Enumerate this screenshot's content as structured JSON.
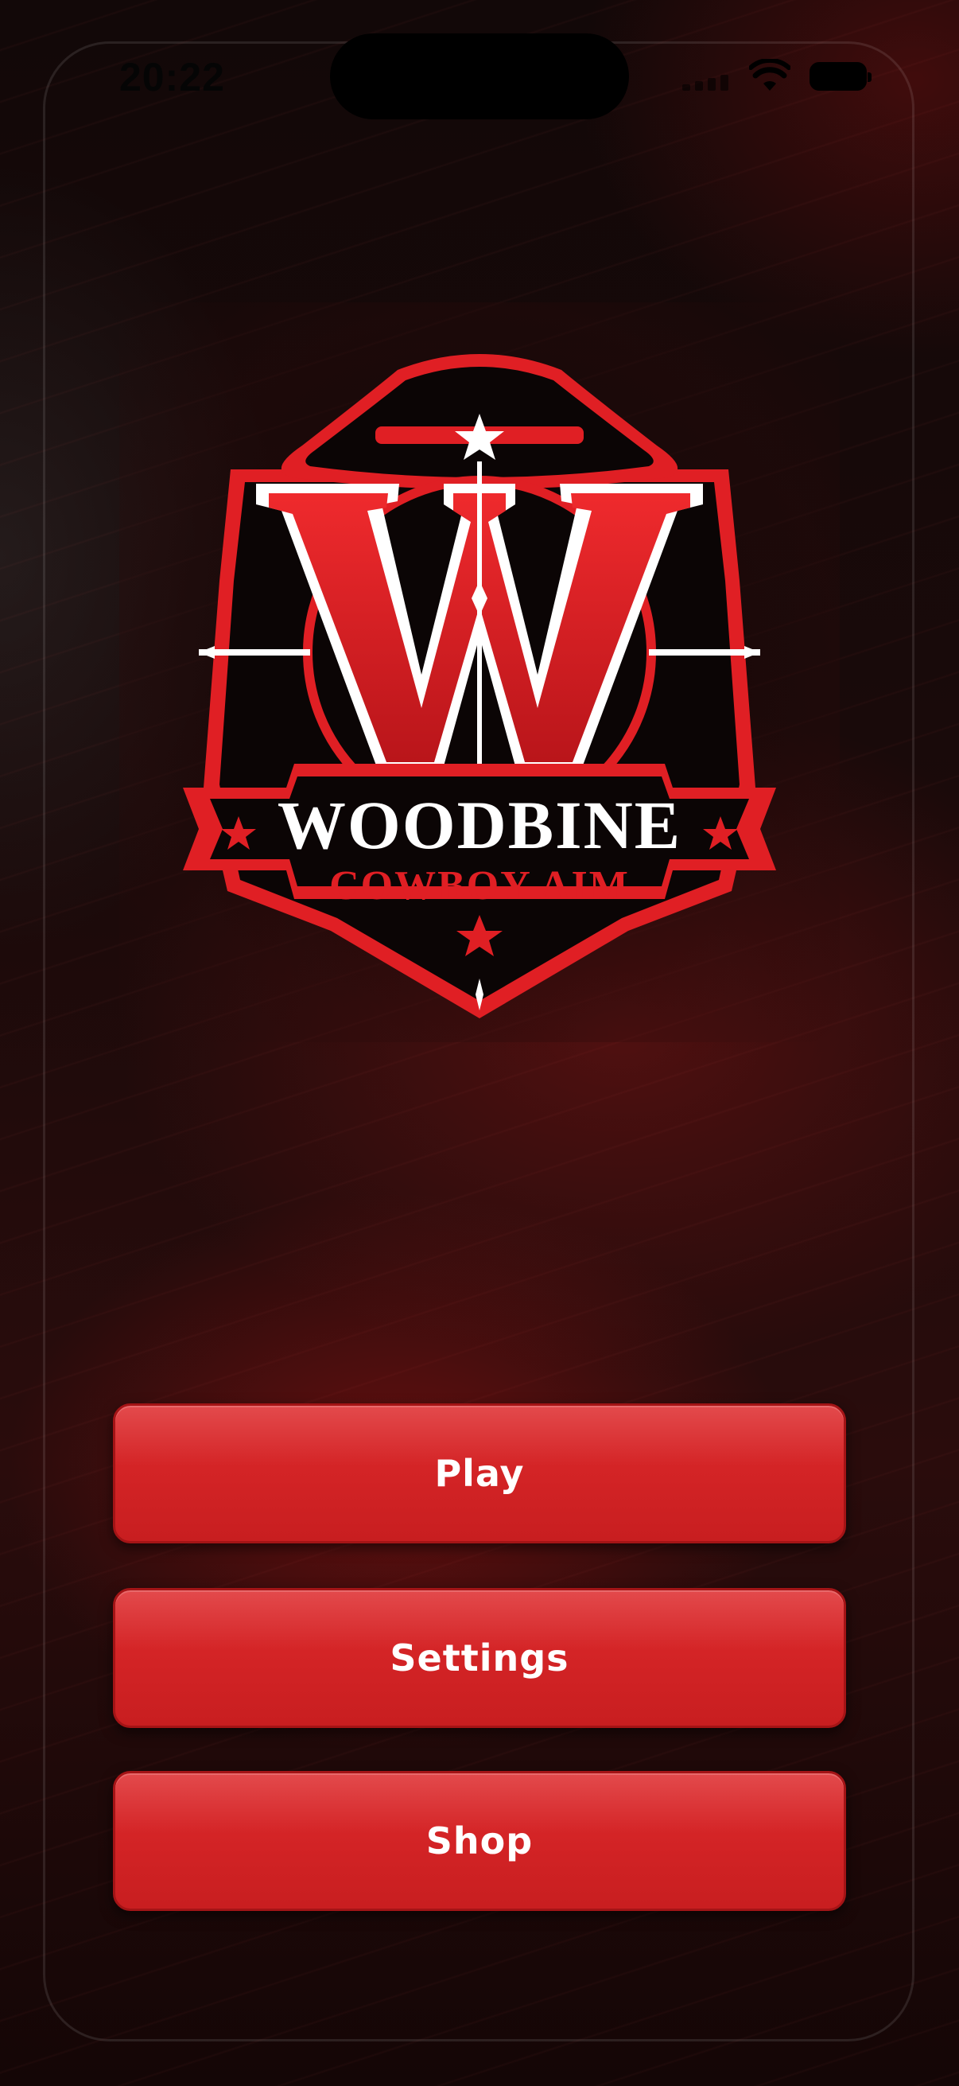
{
  "status_bar": {
    "time": "20:22",
    "icons": [
      "cellular-signal-icon",
      "wifi-icon",
      "battery-icon"
    ]
  },
  "logo": {
    "monogram": "W",
    "title": "WOODBINE",
    "subtitle": "COWBOY AIM"
  },
  "menu": {
    "play_label": "Play",
    "settings_label": "Settings",
    "shop_label": "Shop"
  },
  "colors": {
    "accent": "#d42426",
    "accent_dark": "#a41416",
    "background": "#1a0a0a",
    "text": "#ffffff"
  }
}
